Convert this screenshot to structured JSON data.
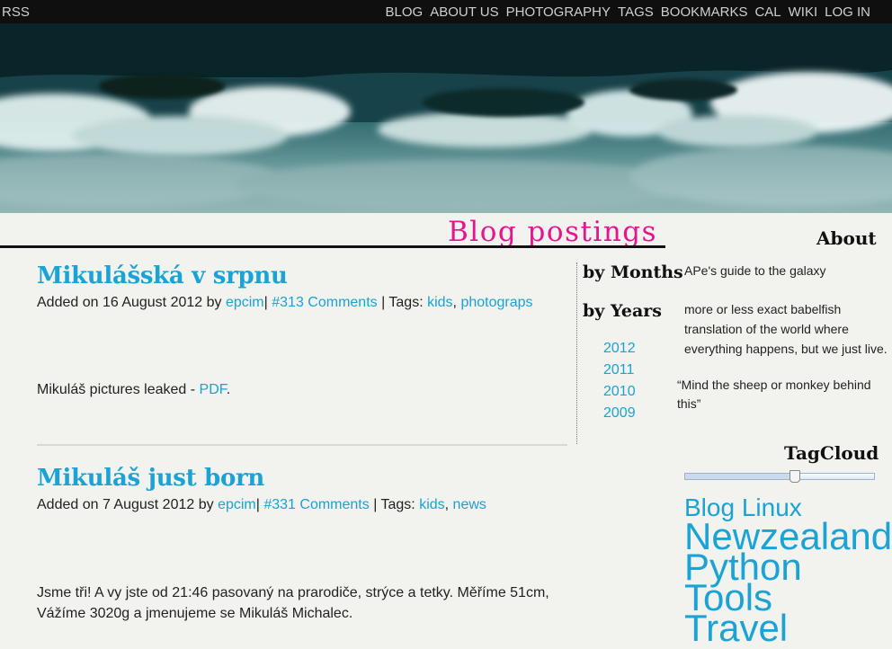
{
  "topbar": {
    "rss": "RSS",
    "nav": [
      "BLOG",
      "ABOUT US",
      "PHOTOGRAPHY",
      "TAGS",
      "BOOKMARKS",
      "CAL",
      "WIKI",
      "LOG IN"
    ]
  },
  "page": {
    "title": "Blog postings"
  },
  "posts": [
    {
      "title": "Mikulášská v srpnu",
      "added_prefix": "Added on 16 August 2012 by ",
      "author": "epcim",
      "comments": "#313 Comments",
      "tags_prefix": " | Tags: ",
      "tags": [
        "kids",
        "photograps"
      ],
      "body_text": "Mikuláš pictures leaked - ",
      "body_link": "PDF",
      "body_end": "."
    },
    {
      "title": "Mikuláš just born",
      "added_prefix": "Added on 7 August 2012 by ",
      "author": "epcim",
      "comments": "#331 Comments",
      "tags_prefix": " | Tags: ",
      "tags": [
        "kids",
        "news"
      ],
      "body_line1": "Jsme tři! A vy jste od 21:46 pasovaný na prarodiče, strýce a tetky. Měříme 51cm,",
      "body_line2": "Vážíme 3020g a jmenujeme se Mikuláš Michalec."
    }
  ],
  "archive": {
    "by_months": "by Months",
    "by_years": "by Years",
    "years": [
      "2012",
      "2011",
      "2010",
      "2009"
    ]
  },
  "sidebar": {
    "about_heading": "About",
    "about_line1": "APe's guide to the galaxy",
    "about_line2": "more or less exact babelfish translation of the world where everything happens, but we just live.",
    "quote": "“Mind the sheep or monkey behind this”",
    "tagcloud_heading": "TagCloud",
    "tags": [
      "Blog",
      "Linux",
      "Newzealand",
      "Python",
      "Tools",
      "Travel"
    ]
  },
  "colors": {
    "link": "#1aa3d4",
    "title_pink": "#e5158f",
    "topbar": "#0f0f0f"
  }
}
